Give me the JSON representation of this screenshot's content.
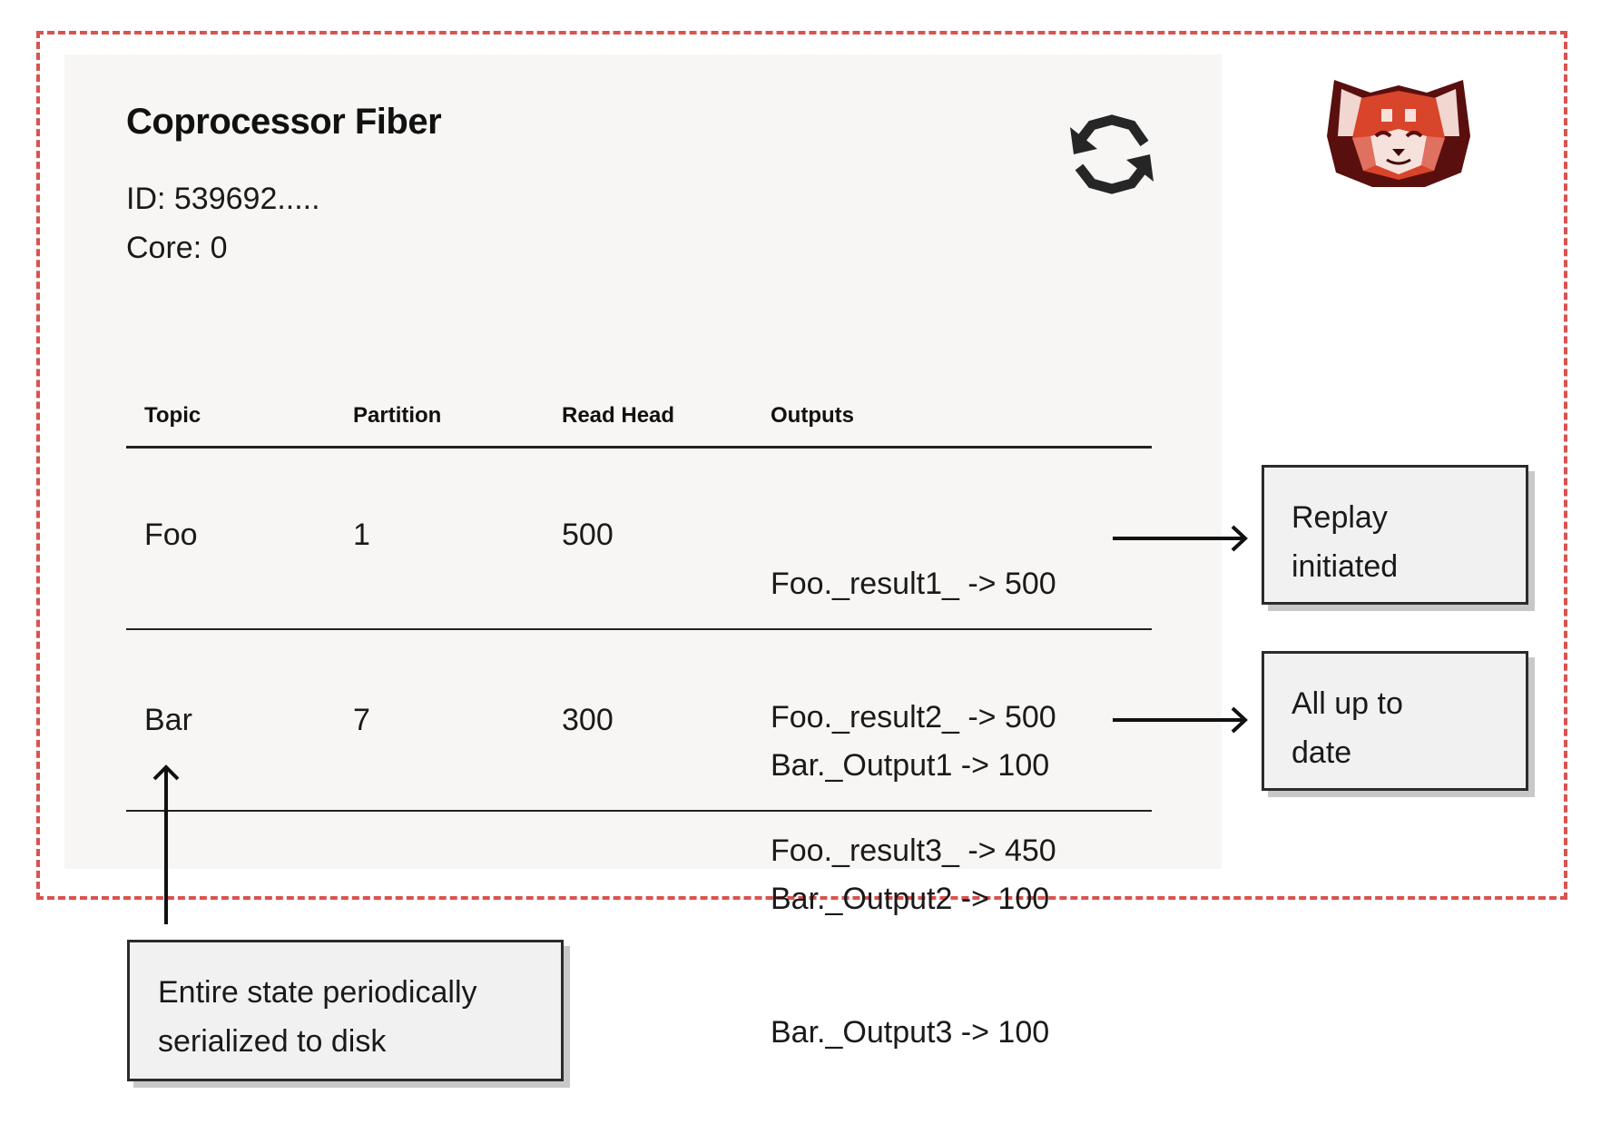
{
  "card": {
    "title": "Coprocessor Fiber",
    "id_text": "ID: 539692.....",
    "core_text": "Core: 0",
    "refresh_icon": "refresh-cycle-icon",
    "logo": "red-panda-logo"
  },
  "table": {
    "headers": [
      "Topic",
      "Partition",
      "Read Head",
      "Outputs"
    ],
    "rows": [
      {
        "topic": "Foo",
        "partition": "1",
        "read_head": "500",
        "outputs": [
          "Foo._result1_ -> 500",
          "Foo._result2_ -> 500",
          "Foo._result3_ -> 450"
        ]
      },
      {
        "topic": "Bar",
        "partition": "7",
        "read_head": "300",
        "outputs": [
          "Bar._Output1 -> 100",
          "Bar._Output2 -> 100",
          "Bar._Output3 -> 100"
        ]
      }
    ]
  },
  "callouts": {
    "replay": [
      "Replay",
      "initiated"
    ],
    "uptodate": [
      "All up to",
      "date"
    ],
    "serialize": [
      "Entire state periodically",
      "serialized to disk"
    ]
  },
  "colors": {
    "dashed_border": "#d9534f",
    "panel_bg": "#f7f6f4",
    "callout_bg": "#f1f1f1",
    "logo_red": "#d8452a",
    "logo_dark": "#5a0f0f"
  }
}
